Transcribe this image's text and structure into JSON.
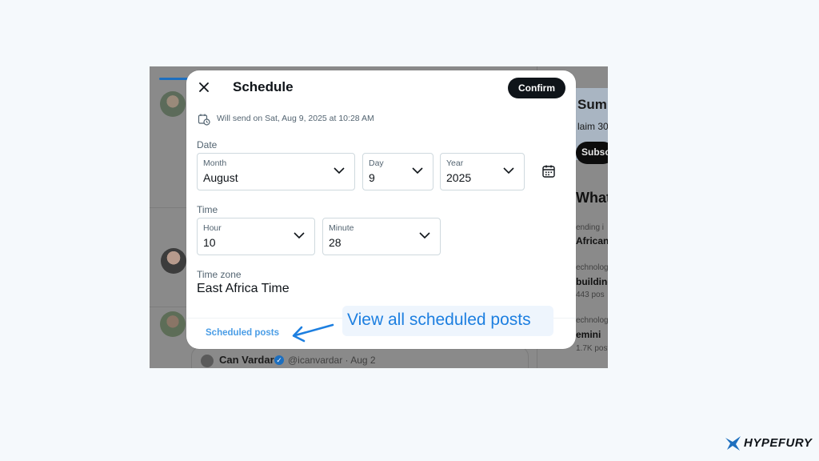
{
  "background_screen": {
    "right_column": {
      "card_title": "Summ",
      "card_text": "laim 30",
      "card_button": "Subsc",
      "whats_title": "What’",
      "trend1_meta": "ending i",
      "trend1_title": "African",
      "trend2_meta": "echnolog",
      "trend2_title": "building",
      "trend2_count": "443 pos",
      "trend3_meta": "echnolog",
      "trend3_title": "emini",
      "trend3_count": "1.7K post"
    },
    "quoted_post": {
      "name": "Can Vardar",
      "handle_date": "@icanvardar · Aug 2"
    }
  },
  "modal": {
    "title": "Schedule",
    "confirm_label": "Confirm",
    "send_summary": "Will send on Sat, Aug 9, 2025 at 10:28 AM",
    "date_label": "Date",
    "month": {
      "label": "Month",
      "value": "August"
    },
    "day": {
      "label": "Day",
      "value": "9"
    },
    "year": {
      "label": "Year",
      "value": "2025"
    },
    "time_label": "Time",
    "hour": {
      "label": "Hour",
      "value": "10"
    },
    "minute": {
      "label": "Minute",
      "value": "28"
    },
    "timezone_label": "Time zone",
    "timezone_value": "East Africa Time",
    "scheduled_posts_link": "Scheduled posts"
  },
  "annotation": {
    "text": "View all scheduled posts",
    "color": "#1d7fe0"
  },
  "brand": {
    "name": "HYPEFURY",
    "icon": "hypefury-logo-icon"
  }
}
